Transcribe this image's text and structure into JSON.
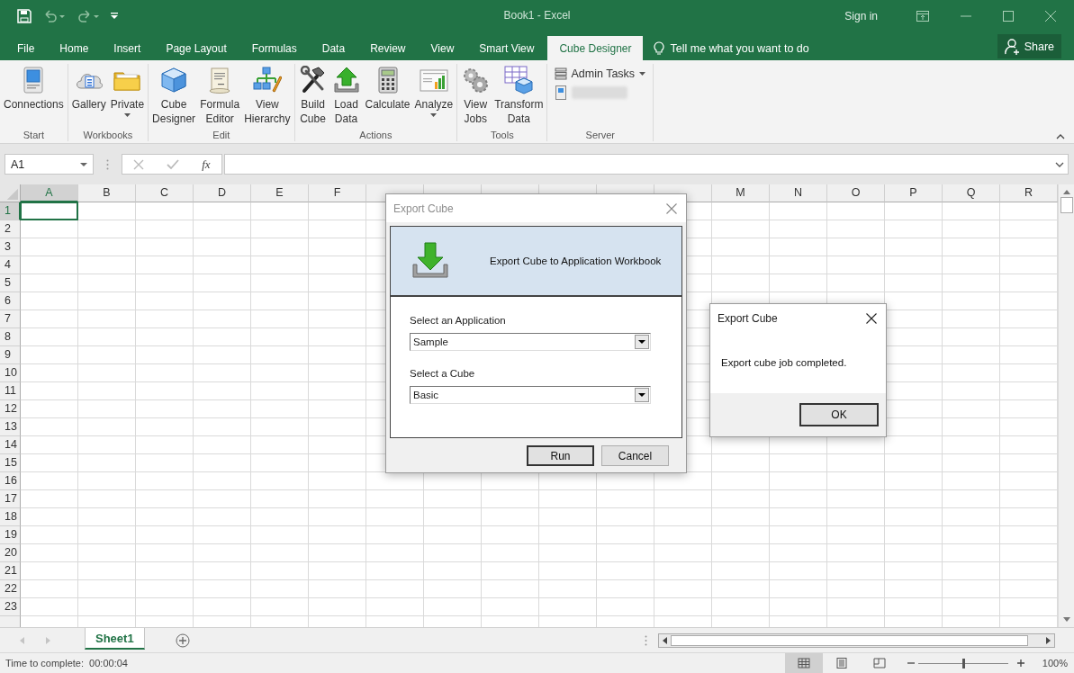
{
  "title_bar": {
    "title": "Book1 - Excel",
    "sign_in": "Sign in"
  },
  "ribbon_tabs": [
    {
      "label": "File",
      "selected": false
    },
    {
      "label": "Home",
      "selected": false
    },
    {
      "label": "Insert",
      "selected": false
    },
    {
      "label": "Page Layout",
      "selected": false
    },
    {
      "label": "Formulas",
      "selected": false
    },
    {
      "label": "Data",
      "selected": false
    },
    {
      "label": "Review",
      "selected": false
    },
    {
      "label": "View",
      "selected": false
    },
    {
      "label": "Smart View",
      "selected": false
    },
    {
      "label": "Cube Designer",
      "selected": true
    }
  ],
  "tell_me": "Tell me what you want to do",
  "share": "Share",
  "ribbon_groups": [
    {
      "label": "Start",
      "buttons": [
        {
          "kind": "large",
          "label": "Connections",
          "dropdown": false
        }
      ]
    },
    {
      "label": "Workbooks",
      "buttons": [
        {
          "kind": "large",
          "label": "Gallery",
          "dropdown": false
        },
        {
          "kind": "large",
          "label": "Private",
          "dropdown": true
        }
      ]
    },
    {
      "label": "Edit",
      "buttons": [
        {
          "kind": "large",
          "label": "Cube\nDesigner",
          "dropdown": false
        },
        {
          "kind": "large",
          "label": "Formula\nEditor",
          "dropdown": false
        },
        {
          "kind": "large",
          "label": "View\nHierarchy",
          "dropdown": false
        }
      ]
    },
    {
      "label": "Actions",
      "buttons": [
        {
          "kind": "large",
          "label": "Build\nCube",
          "dropdown": false
        },
        {
          "kind": "large",
          "label": "Load\nData",
          "dropdown": false
        },
        {
          "kind": "large",
          "label": "Calculate",
          "dropdown": false
        },
        {
          "kind": "large",
          "label": "Analyze",
          "dropdown": true
        }
      ]
    },
    {
      "label": "Tools",
      "buttons": [
        {
          "kind": "large",
          "label": "View\nJobs",
          "dropdown": false
        },
        {
          "kind": "large",
          "label": "Transform\nData",
          "dropdown": false
        }
      ]
    },
    {
      "label": "Server",
      "buttons": [
        {
          "kind": "small",
          "label": "Admin Tasks",
          "dropdown": true
        },
        {
          "kind": "blurred"
        }
      ]
    }
  ],
  "formula_bar": {
    "name_box": "A1",
    "function_button": "fx"
  },
  "grid": {
    "columns": [
      {
        "label": "A",
        "selected": true
      },
      {
        "label": "B",
        "selected": false
      },
      {
        "label": "C",
        "selected": false
      },
      {
        "label": "D",
        "selected": false
      },
      {
        "label": "E",
        "selected": false
      },
      {
        "label": "F",
        "selected": false
      },
      {
        "selected": false
      },
      {
        "selected": false
      },
      {
        "selected": false
      },
      {
        "selected": false
      },
      {
        "selected": false
      },
      {
        "selected": false
      },
      {
        "label": "M",
        "selected": false
      },
      {
        "label": "N",
        "selected": false
      },
      {
        "label": "O",
        "selected": false
      },
      {
        "label": "P",
        "selected": false
      },
      {
        "label": "Q",
        "selected": false
      },
      {
        "label": "R",
        "selected": false
      }
    ],
    "rows": [
      {
        "label": "1",
        "selected": true
      },
      {
        "label": "2",
        "selected": false
      },
      {
        "label": "3",
        "selected": false
      },
      {
        "label": "4",
        "selected": false
      },
      {
        "label": "5",
        "selected": false
      },
      {
        "label": "6",
        "selected": false
      },
      {
        "label": "7",
        "selected": false
      },
      {
        "label": "8",
        "selected": false
      },
      {
        "label": "9",
        "selected": false
      },
      {
        "label": "10",
        "selected": false
      },
      {
        "label": "11",
        "selected": false
      },
      {
        "label": "12",
        "selected": false
      },
      {
        "label": "13",
        "selected": false
      },
      {
        "label": "14",
        "selected": false
      },
      {
        "label": "15",
        "selected": false
      },
      {
        "label": "16",
        "selected": false
      },
      {
        "label": "17",
        "selected": false
      },
      {
        "label": "18",
        "selected": false
      },
      {
        "label": "19",
        "selected": false
      },
      {
        "label": "20",
        "selected": false
      },
      {
        "label": "21",
        "selected": false
      },
      {
        "label": "22",
        "selected": false
      },
      {
        "label": "23",
        "selected": false
      }
    ]
  },
  "sheet_tabs": [
    {
      "label": "Sheet1",
      "selected": true
    }
  ],
  "status_bar": {
    "message": "Time to complete:  00:00:04",
    "views": [
      {
        "kind": "normal",
        "selected": true
      },
      {
        "kind": "page_layout",
        "selected": false
      },
      {
        "kind": "page_break",
        "selected": false
      }
    ],
    "zoom": {
      "level": 0.5
    },
    "zoom_label": "100%"
  },
  "export_dialog": {
    "title": "Export Cube",
    "active": false,
    "header": "Export Cube to Application Workbook",
    "fields": [
      {
        "label": "Select an Application",
        "value": "Sample"
      },
      {
        "label": "Select a Cube",
        "value": "Basic"
      }
    ],
    "buttons": [
      {
        "label": "Run",
        "default": true
      },
      {
        "label": "Cancel",
        "default": false
      }
    ]
  },
  "message_dialog": {
    "title": "Export Cube",
    "active": true,
    "message": "Export cube job completed.",
    "buttons": [
      {
        "label": "OK",
        "default": true
      }
    ]
  }
}
